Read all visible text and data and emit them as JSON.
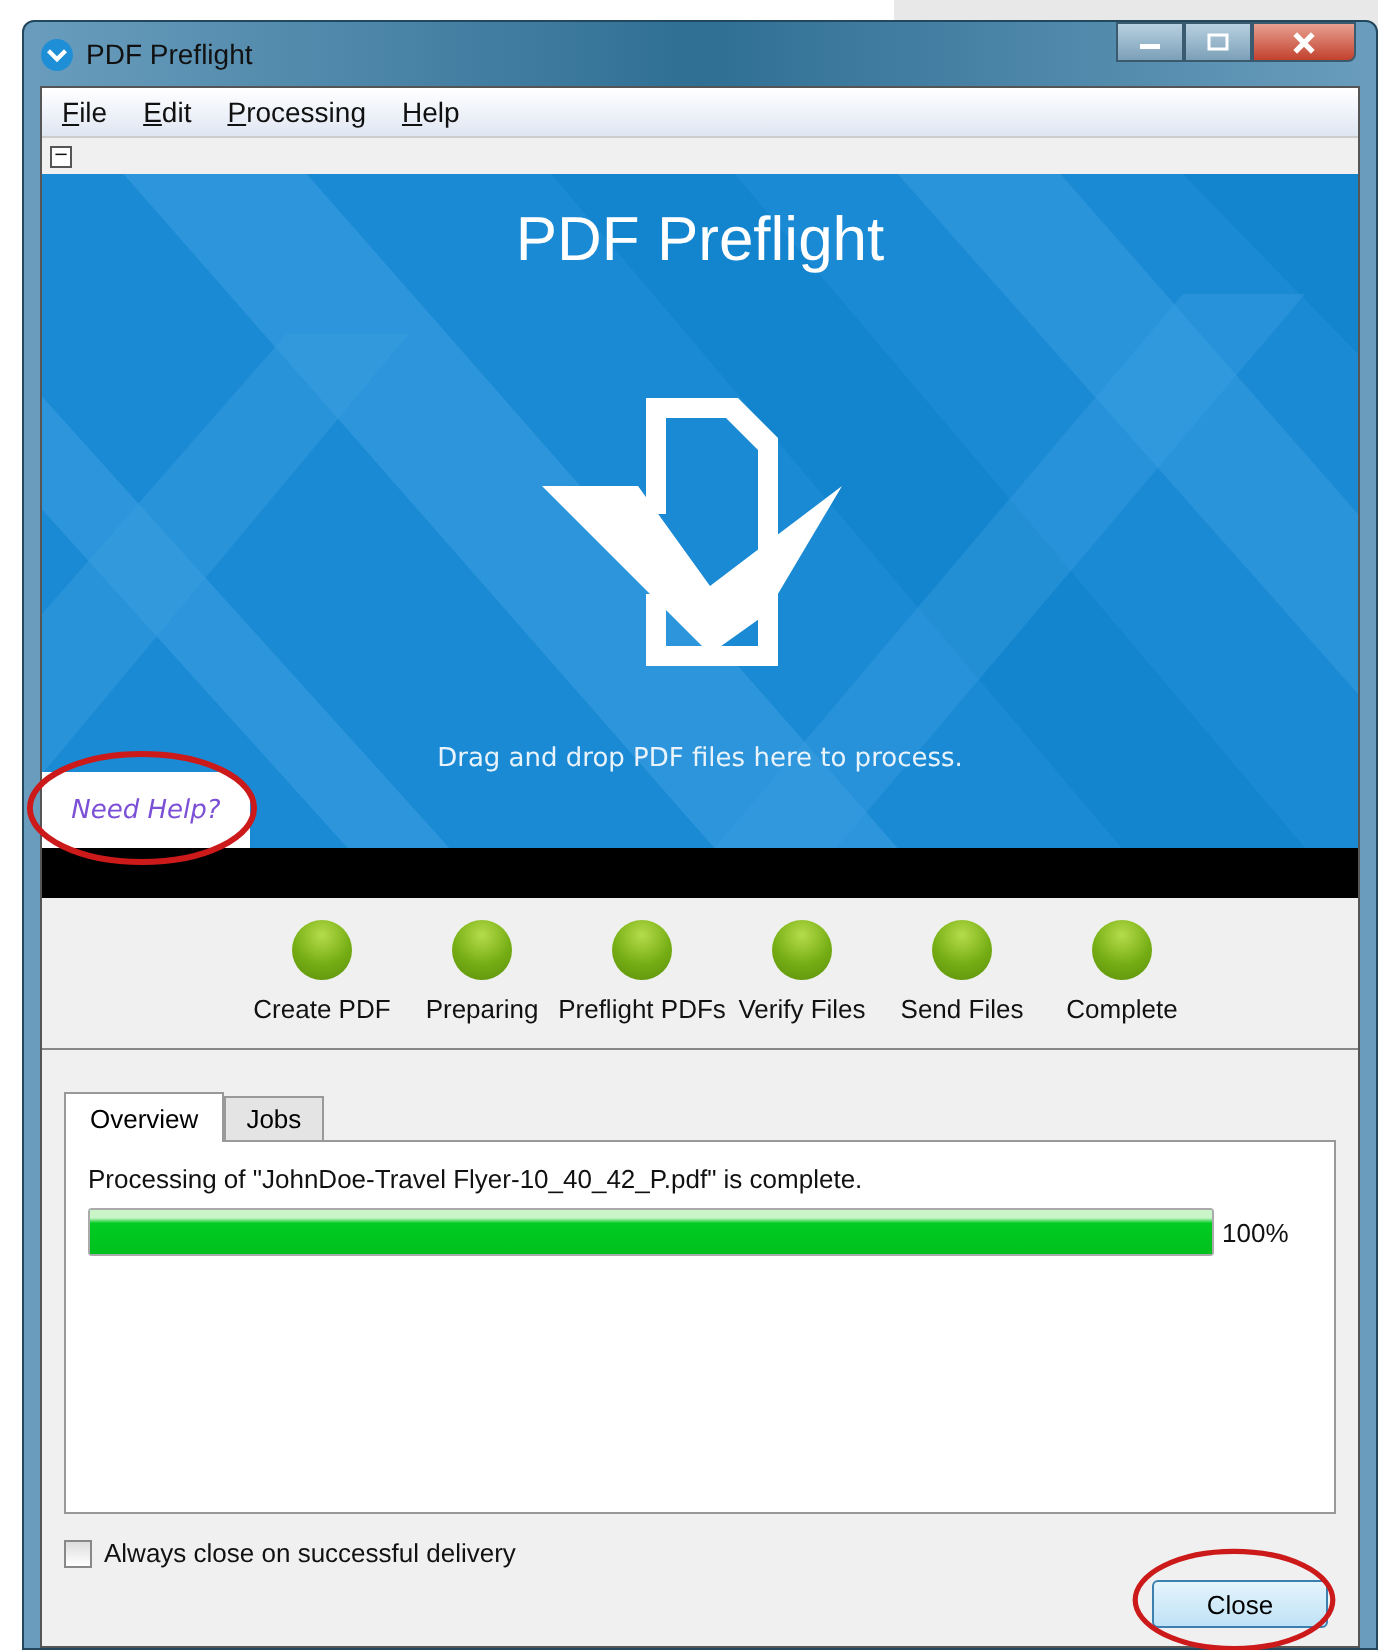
{
  "window": {
    "title": "PDF Preflight"
  },
  "menu": [
    {
      "label": "File"
    },
    {
      "label": "Edit"
    },
    {
      "label": "Processing"
    },
    {
      "label": "Help"
    }
  ],
  "toolbar": {
    "collapse_symbol": "−"
  },
  "banner": {
    "title": "PDF Preflight",
    "hint": "Drag and drop PDF files here to process.",
    "help_link": "Need Help?"
  },
  "stages": [
    {
      "label": "Create PDF",
      "done": true
    },
    {
      "label": "Preparing",
      "done": true
    },
    {
      "label": "Preflight PDFs",
      "done": true
    },
    {
      "label": "Verify Files",
      "done": true
    },
    {
      "label": "Send Files",
      "done": true
    },
    {
      "label": "Complete",
      "done": true
    }
  ],
  "tabs": [
    {
      "label": "Overview",
      "selected": true
    },
    {
      "label": "Jobs",
      "selected": false
    }
  ],
  "overview": {
    "message": "Processing of \"JohnDoe-Travel Flyer-10_40_42_P.pdf\" is complete.",
    "level": 1,
    "reading": "100%"
  },
  "always_close": {
    "label": "Always close on successful delivery",
    "checked": false
  },
  "buttons": [
    {
      "label": "Close"
    }
  ]
}
